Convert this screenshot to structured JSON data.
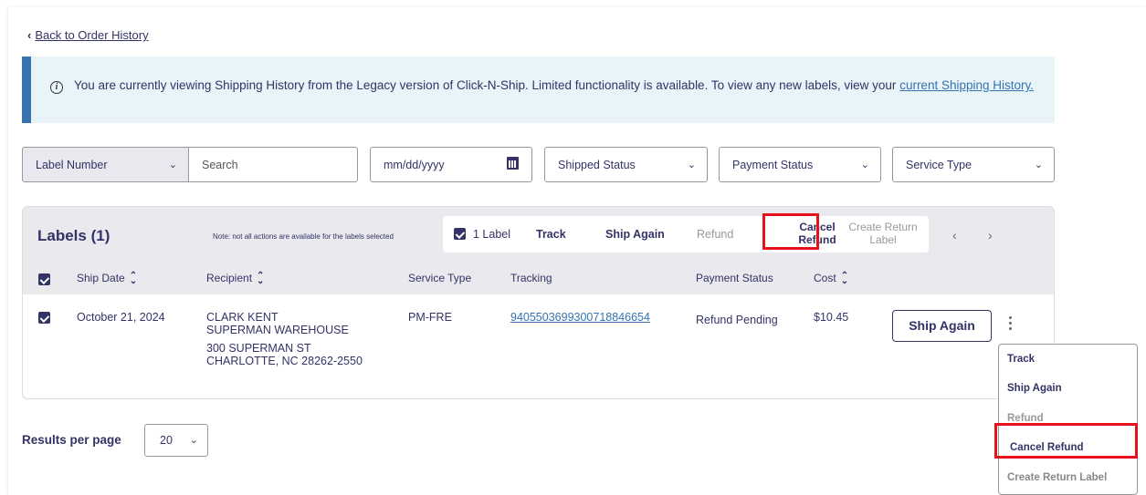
{
  "back_link": {
    "label": "Back to Order History"
  },
  "alert": {
    "text": "You are currently viewing Shipping History from the Legacy version of Click-N-Ship. Limited functionality is available. To view any new labels, view your",
    "link": "current Shipping History."
  },
  "filters": {
    "label_type": "Label Number",
    "search_placeholder": "Search",
    "date_placeholder": "mm/dd/yyyy",
    "shipped_status": "Shipped Status",
    "payment_status": "Payment Status",
    "service_type": "Service Type"
  },
  "labels_panel": {
    "title": "Labels (1)",
    "note": "Note: not all actions are available for the labels selected",
    "selected_count": "1 Label",
    "actions": {
      "track": "Track",
      "ship_again": "Ship Again",
      "refund": "Refund",
      "cancel_refund_line1": "Cancel",
      "cancel_refund_line2": "Refund",
      "create_return_line1": "Create Return",
      "create_return_line2": "Label"
    },
    "columns": {
      "ship_date": "Ship Date",
      "recipient": "Recipient",
      "service_type": "Service Type",
      "tracking": "Tracking",
      "payment_status": "Payment Status",
      "cost": "Cost"
    },
    "rows": [
      {
        "ship_date": "October 21, 2024",
        "recipient_name": "CLARK KENT",
        "recipient_company": "SUPERMAN WAREHOUSE",
        "recipient_street": "300 SUPERMAN ST",
        "recipient_city": "CHARLOTTE, NC 28262-2550",
        "service_type": "PM-FRE",
        "tracking": "9405503699300718846654",
        "payment_status": "Refund Pending",
        "cost": "$10.45",
        "ship_again_label": "Ship Again"
      }
    ]
  },
  "row_menu": {
    "items": [
      "Track",
      "Ship Again",
      "Refund",
      "Cancel Refund",
      "Create Return Label"
    ]
  },
  "pagination": {
    "results_label": "Results per page",
    "per_page": "20"
  },
  "colors": {
    "primary": "#333366",
    "link": "#3573b1",
    "highlight": "#e8101a",
    "alert_bg": "#e8f4f8"
  }
}
